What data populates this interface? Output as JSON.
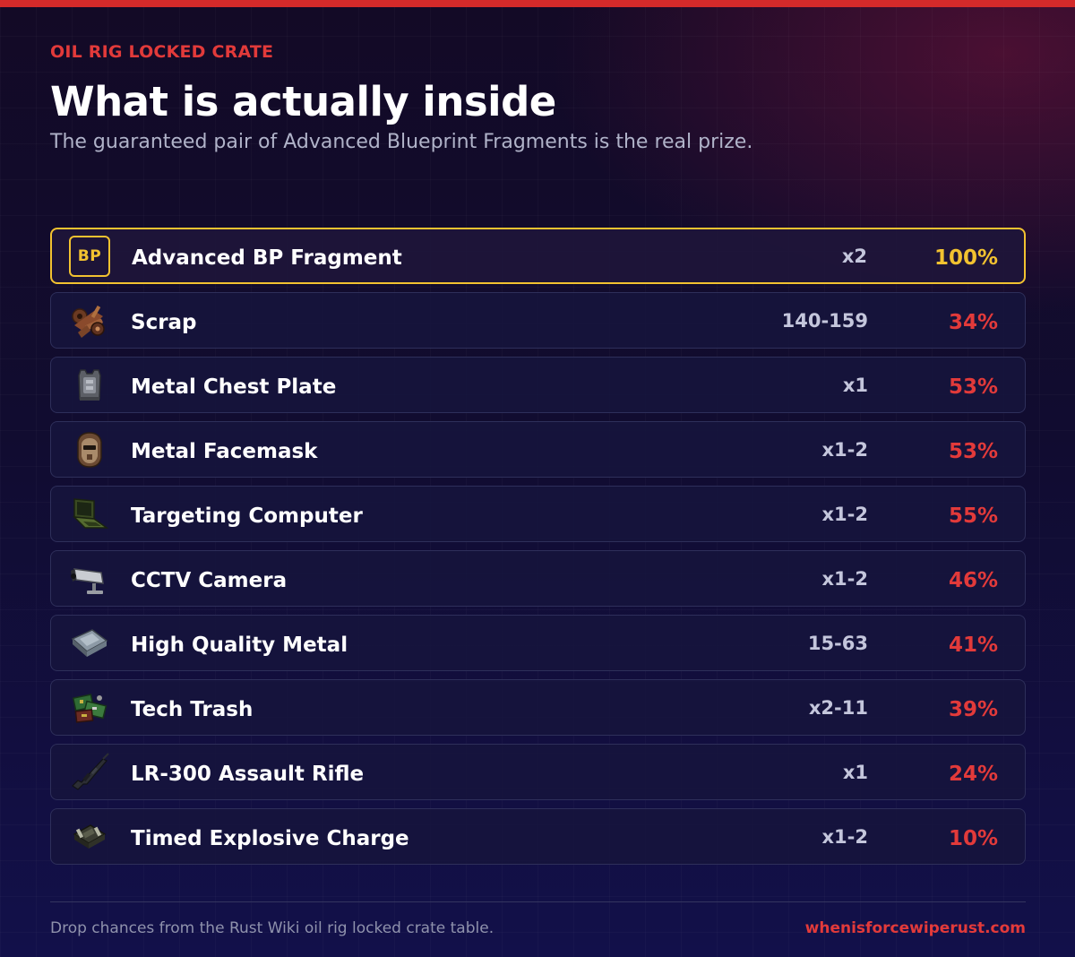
{
  "header": {
    "eyebrow": "OIL RIG LOCKED CRATE",
    "title": "What is actually inside",
    "subtitle": "The guaranteed pair of Advanced Blueprint Fragments is the real prize."
  },
  "colors": {
    "accent_red": "#e23a3a",
    "accent_gold": "#f2c230",
    "top_bar": "#d42a2a",
    "row_border": "#2e2f5a"
  },
  "loot": [
    {
      "name": "Advanced BP Fragment",
      "quantity": "x2",
      "chance": "100%",
      "chance_color": "#f2c230",
      "icon": "bp",
      "icon_text": "BP",
      "featured": true
    },
    {
      "name": "Scrap",
      "quantity": "140-159",
      "chance": "34%",
      "chance_color": "#e23a3a",
      "icon": "scrap-icon"
    },
    {
      "name": "Metal Chest Plate",
      "quantity": "x1",
      "chance": "53%",
      "chance_color": "#e23a3a",
      "icon": "chest-plate-icon"
    },
    {
      "name": "Metal Facemask",
      "quantity": "x1-2",
      "chance": "53%",
      "chance_color": "#e23a3a",
      "icon": "facemask-icon"
    },
    {
      "name": "Targeting Computer",
      "quantity": "x1-2",
      "chance": "55%",
      "chance_color": "#e23a3a",
      "icon": "laptop-icon"
    },
    {
      "name": "CCTV Camera",
      "quantity": "x1-2",
      "chance": "46%",
      "chance_color": "#e23a3a",
      "icon": "cctv-camera-icon"
    },
    {
      "name": "High Quality Metal",
      "quantity": "15-63",
      "chance": "41%",
      "chance_color": "#e23a3a",
      "icon": "metal-ingot-icon"
    },
    {
      "name": "Tech Trash",
      "quantity": "x2-11",
      "chance": "39%",
      "chance_color": "#e23a3a",
      "icon": "tech-trash-icon"
    },
    {
      "name": "LR-300 Assault Rifle",
      "quantity": "x1",
      "chance": "24%",
      "chance_color": "#e23a3a",
      "icon": "rifle-icon"
    },
    {
      "name": "Timed Explosive Charge",
      "quantity": "x1-2",
      "chance": "10%",
      "chance_color": "#e23a3a",
      "icon": "explosive-charge-icon"
    }
  ],
  "footer": {
    "note": "Drop chances from the Rust Wiki oil rig locked crate table.",
    "link": "whenisforcewiperust.com"
  }
}
